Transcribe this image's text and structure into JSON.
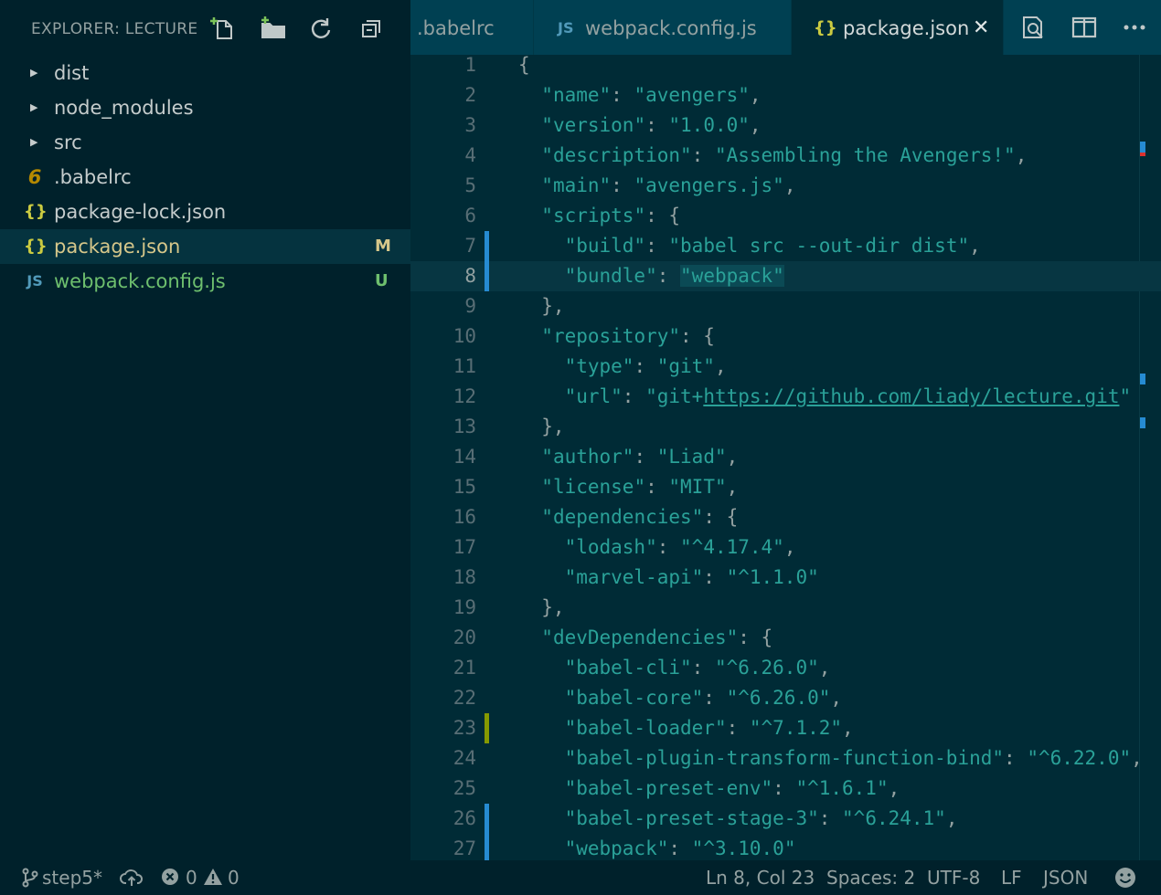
{
  "sidebar": {
    "title": "EXPLORER: LECTURE",
    "actions": [
      "new-file-icon",
      "new-folder-icon",
      "refresh-icon",
      "collapse-all-icon"
    ],
    "items": [
      {
        "type": "folder",
        "label": "dist",
        "icon": "chevron-right-icon"
      },
      {
        "type": "folder",
        "label": "node_modules",
        "icon": "chevron-right-icon"
      },
      {
        "type": "folder",
        "label": "src",
        "icon": "chevron-right-icon"
      },
      {
        "type": "file",
        "label": ".babelrc",
        "icon_glyph": "6",
        "icon_color": "#b58900",
        "label_color": "#c5cccc",
        "badge": ""
      },
      {
        "type": "file",
        "label": "package-lock.json",
        "icon_glyph": "{}",
        "icon_color": "#cbcb41",
        "label_color": "#c5cccc",
        "badge": ""
      },
      {
        "type": "file",
        "label": "package.json",
        "icon_glyph": "{}",
        "icon_color": "#cbcb41",
        "label_color": "#d6c78a",
        "badge": "M",
        "badge_color": "#d6c78a",
        "selected": true
      },
      {
        "type": "file",
        "label": "webpack.config.js",
        "icon_glyph": "JS",
        "icon_color": "#519aba",
        "label_color": "#6ebf6e",
        "badge": "U",
        "badge_color": "#6ebf6e"
      }
    ]
  },
  "tabs": [
    {
      "label": ".babelrc",
      "icon_glyph": "",
      "active": false
    },
    {
      "label": "webpack.config.js",
      "icon_glyph": "JS",
      "icon_color": "#519aba",
      "active": false
    },
    {
      "label": "package.json",
      "icon_glyph": "{}",
      "icon_color": "#cbcb41",
      "active": true,
      "close": "✕"
    }
  ],
  "tab_actions": [
    "open-preview-icon",
    "split-editor-icon",
    "more-actions-icon"
  ],
  "editor": {
    "current_line": 8,
    "lines": [
      {
        "n": "1",
        "text": "{"
      },
      {
        "n": "2",
        "text": "  \"name\": \"avengers\","
      },
      {
        "n": "3",
        "text": "  \"version\": \"1.0.0\","
      },
      {
        "n": "4",
        "text": "  \"description\": \"Assembling the Avengers!\","
      },
      {
        "n": "5",
        "text": "  \"main\": \"avengers.js\","
      },
      {
        "n": "6",
        "text": "  \"scripts\": {"
      },
      {
        "n": "7",
        "text": "    \"build\": \"babel src --out-dir dist\",",
        "gutter": "#268bd2"
      },
      {
        "n": "8",
        "text": "    \"bundle\": \"webpack\"",
        "gutter": "#268bd2"
      },
      {
        "n": "9",
        "text": "  },"
      },
      {
        "n": "10",
        "text": "  \"repository\": {"
      },
      {
        "n": "11",
        "text": "    \"type\": \"git\","
      },
      {
        "n": "12",
        "text": "    \"url\": \"git+https://github.com/liady/lecture.git\""
      },
      {
        "n": "13",
        "text": "  },"
      },
      {
        "n": "14",
        "text": "  \"author\": \"Liad\","
      },
      {
        "n": "15",
        "text": "  \"license\": \"MIT\","
      },
      {
        "n": "16",
        "text": "  \"dependencies\": {"
      },
      {
        "n": "17",
        "text": "    \"lodash\": \"^4.17.4\","
      },
      {
        "n": "18",
        "text": "    \"marvel-api\": \"^1.1.0\""
      },
      {
        "n": "19",
        "text": "  },"
      },
      {
        "n": "20",
        "text": "  \"devDependencies\": {"
      },
      {
        "n": "21",
        "text": "    \"babel-cli\": \"^6.26.0\","
      },
      {
        "n": "22",
        "text": "    \"babel-core\": \"^6.26.0\","
      },
      {
        "n": "23",
        "text": "    \"babel-loader\": \"^7.1.2\",",
        "gutter": "#859900"
      },
      {
        "n": "24",
        "text": "    \"babel-plugin-transform-function-bind\": \"^6.22.0\","
      },
      {
        "n": "25",
        "text": "    \"babel-preset-env\": \"^1.6.1\","
      },
      {
        "n": "26",
        "text": "    \"babel-preset-stage-3\": \"^6.24.1\",",
        "gutter": "#268bd2"
      },
      {
        "n": "27",
        "text": "    \"webpack\": \"^3.10.0\"",
        "gutter": "#268bd2"
      }
    ]
  },
  "statusbar": {
    "branch": "step5*",
    "branch_icon": "git-branch-icon",
    "sync_icon": "cloud-upload-icon",
    "errors": "0",
    "warnings": "0",
    "position": "Ln 8, Col 23",
    "spaces": "Spaces: 2",
    "encoding": "UTF-8",
    "eol": "LF",
    "language": "JSON",
    "feedback_icon": "smiley-icon"
  },
  "colors": {
    "accent_blue": "#268bd2",
    "key_teal": "#2aa198",
    "modified_yellow": "#d6c78a",
    "untracked_green": "#6ebf6e"
  }
}
